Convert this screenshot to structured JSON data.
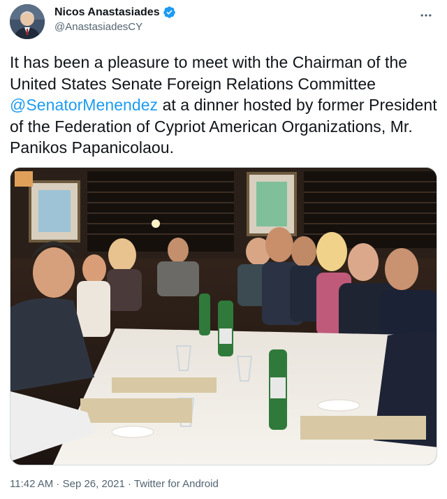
{
  "author": {
    "display_name": "Nicos Anastasiades",
    "handle": "@AnastasiadesCY",
    "verified_icon": "verified-badge-icon"
  },
  "menu": {
    "more_icon": "more-horizontal-icon"
  },
  "tweet": {
    "text_before": "It has been a pleasure to meet with the Chairman of the United States Senate Foreign Relations Committee ",
    "mention": "@SenatorMenendez",
    "text_after": " at a dinner hosted by former President of the Federation of Cypriot American Organizations, Mr. Panikos Papanicolaou."
  },
  "media": {
    "icon": "photo-icon"
  },
  "meta": {
    "time": "11:42 AM",
    "separator1": " · ",
    "date": "Sep 26, 2021",
    "separator2": " · ",
    "source": "Twitter for Android"
  },
  "colors": {
    "accent": "#1d9bf0",
    "text": "#0f1419",
    "secondary": "#536471"
  }
}
